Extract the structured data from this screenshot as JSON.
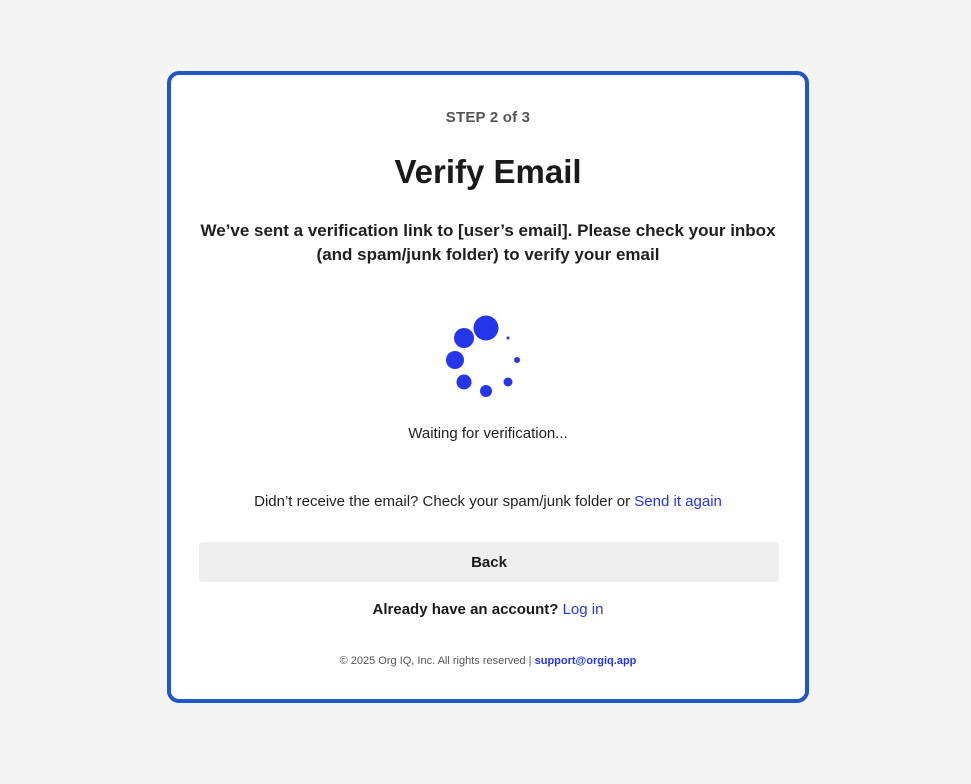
{
  "step": {
    "label": "STEP 2 of 3"
  },
  "title": "Verify Email",
  "subtitle": "We’ve sent a verification link to [user’s email]. Please check your inbox (and spam/junk folder) to verify your email",
  "status": {
    "waiting_text": "Waiting for verification...",
    "spinner_icon": "loading-spinner-icon",
    "accent_color": "#2535e8"
  },
  "resend": {
    "prompt": "Didn’t receive the email? Check your spam/junk folder or ",
    "link_label": "Send it again"
  },
  "back_button": {
    "label": "Back"
  },
  "account": {
    "prompt": "Already have an account? ",
    "link_label": "Log in"
  },
  "footer": {
    "copyright": "© 2025 Org IQ, Inc. All rights reserved | ",
    "support_email": "support@orgiq.app"
  },
  "colors": {
    "brand_border": "#1f56c8",
    "link": "#2535e8",
    "page_background": "#f4f4f4",
    "button_background": "#efefef"
  }
}
